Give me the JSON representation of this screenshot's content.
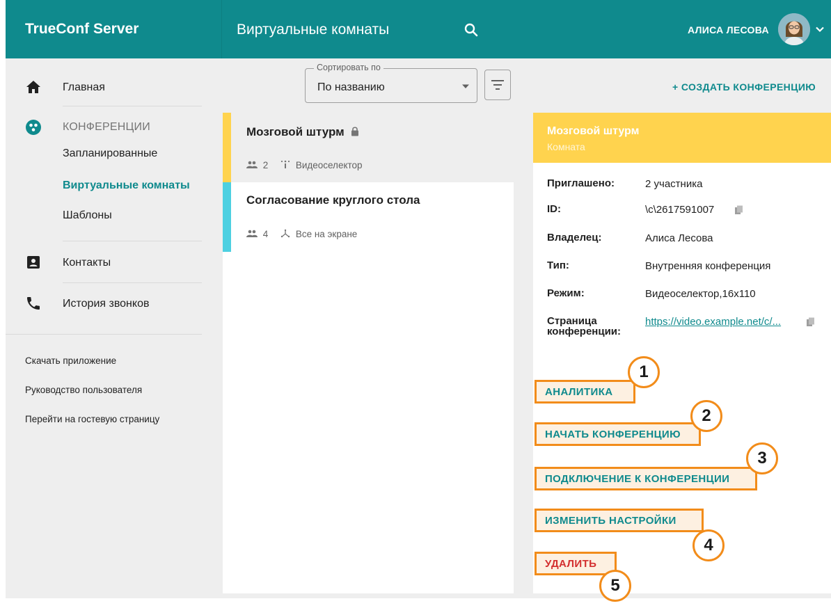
{
  "header": {
    "brand": "TrueConf Server",
    "page_title": "Виртуальные комнаты",
    "user_name": "АЛИСА ЛЕСОВА"
  },
  "sidebar": {
    "home": "Главная",
    "conferences_section": "КОНФЕРЕНЦИИ",
    "scheduled": "Запланированные",
    "virtual_rooms": "Виртуальные комнаты",
    "templates": "Шаблоны",
    "contacts": "Контакты",
    "call_history": "История звонков",
    "links": [
      "Скачать приложение",
      "Руководство пользователя",
      "Перейти на гостевую страницу"
    ]
  },
  "toolbar": {
    "sort_label": "Сортировать по",
    "sort_value": "По названию",
    "create_label": "+ СОЗДАТЬ КОНФЕРЕНЦИЮ"
  },
  "conferences": [
    {
      "name": "Мозговой штурм",
      "participants": "2",
      "mode": "Видеоселектор",
      "color": "#ffd34e",
      "locked": true
    },
    {
      "name": "Согласование круглого стола",
      "participants": "4",
      "mode": "Все на экране",
      "color": "#4dd0e1",
      "locked": false
    }
  ],
  "details": {
    "title": "Мозговой штурм",
    "subtitle": "Комната",
    "rows": [
      {
        "label": "Приглашено:",
        "value": "2 участника"
      },
      {
        "label": "ID:",
        "value": "\\c\\2617591007"
      },
      {
        "label": "Владелец:",
        "value": "Алиса Лесова"
      },
      {
        "label": "Тип:",
        "value": "Внутренняя конференция"
      },
      {
        "label": "Режим:",
        "value": "Видеоселектор,16x110"
      }
    ],
    "page_label_line1": "Страница",
    "page_label_line2": "конференции:",
    "page_link": "https://video.example.net/c/..."
  },
  "actions": [
    {
      "label": "АНАЛИТИКА",
      "badge": "1"
    },
    {
      "label": "НАЧАТЬ КОНФЕРЕНЦИЮ",
      "badge": "2"
    },
    {
      "label": "ПОДКЛЮЧЕНИЕ К КОНФЕРЕНЦИИ",
      "badge": "3"
    },
    {
      "label": "ИЗМЕНИТЬ НАСТРОЙКИ",
      "badge": "4"
    },
    {
      "label": "УДАЛИТЬ",
      "badge": "5"
    }
  ],
  "colors": {
    "brand": "#0f8a8d",
    "selected_room": "#ffd34e",
    "second_room": "#4dd0e1",
    "highlight": "#f28c1a",
    "danger": "#d32f2f"
  }
}
